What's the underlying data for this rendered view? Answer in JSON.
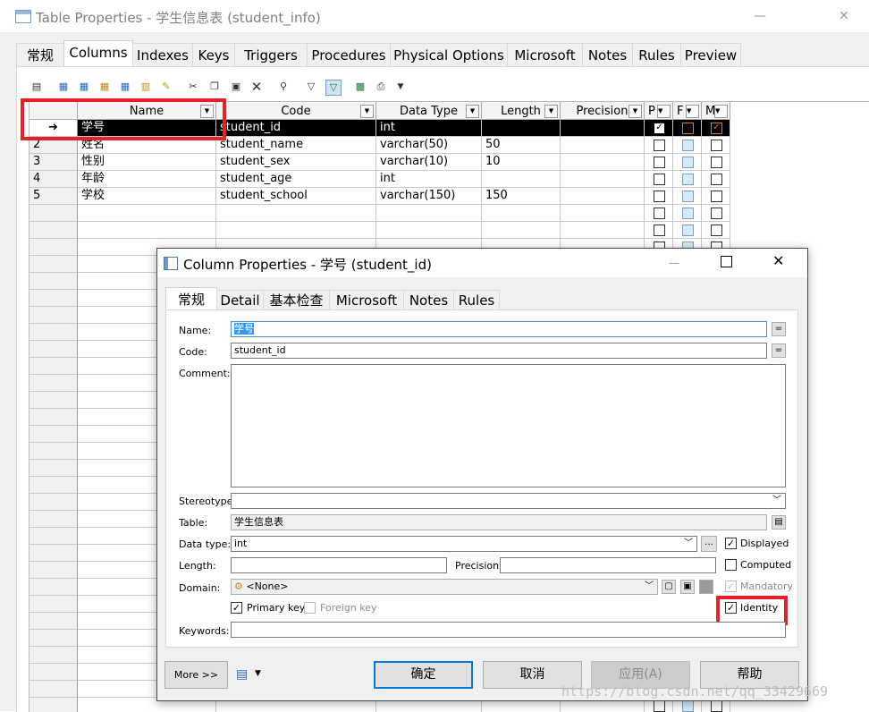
{
  "outer": {
    "title": "Table Properties - 学生信息表 (student_info)",
    "tabs": [
      "常规",
      "Columns",
      "Indexes",
      "Keys",
      "Triggers",
      "Procedures",
      "Physical Options",
      "Microsoft",
      "Notes",
      "Rules",
      "Preview"
    ],
    "active_tab": "Columns"
  },
  "grid": {
    "columns": [
      "Name",
      "Code",
      "Data Type",
      "Length",
      "Precision",
      "P",
      "F",
      "M"
    ],
    "rows": [
      {
        "num": "",
        "name": "学号",
        "code": "student_id",
        "type": "int",
        "length": "",
        "precision": "",
        "p": true,
        "f": false,
        "m": true
      },
      {
        "num": "2",
        "name": "姓名",
        "code": "student_name",
        "type": "varchar(50)",
        "length": "50",
        "precision": "",
        "p": false,
        "f": false,
        "m": false
      },
      {
        "num": "3",
        "name": "性别",
        "code": "student_sex",
        "type": "varchar(10)",
        "length": "10",
        "precision": "",
        "p": false,
        "f": false,
        "m": false
      },
      {
        "num": "4",
        "name": "年龄",
        "code": "student_age",
        "type": "int",
        "length": "",
        "precision": "",
        "p": false,
        "f": false,
        "m": false
      },
      {
        "num": "5",
        "name": "学校",
        "code": "student_school",
        "type": "varchar(150)",
        "length": "150",
        "precision": "",
        "p": false,
        "f": false,
        "m": false
      }
    ]
  },
  "dialog": {
    "title": "Column Properties - 学号 (student_id)",
    "tabs": [
      "常规",
      "Detail",
      "基本检查",
      "Microsoft",
      "Notes",
      "Rules"
    ],
    "active_tab": "常规",
    "labels": {
      "name": "Name:",
      "code": "Code:",
      "comment": "Comment:",
      "stereotype": "Stereotype:",
      "table": "Table:",
      "data_type": "Data type:",
      "length": "Length:",
      "precision": "Precision:",
      "domain": "Domain:",
      "keywords": "Keywords:"
    },
    "values": {
      "name": "学号",
      "code": "student_id",
      "comment": "",
      "stereotype": "",
      "table": "学生信息表",
      "data_type": "int",
      "length": "",
      "precision": "",
      "domain": "<None>",
      "keywords": ""
    },
    "checks": {
      "displayed": {
        "label": "Displayed",
        "checked": true
      },
      "computed": {
        "label": "Computed",
        "checked": false
      },
      "mandatory": {
        "label": "Mandatory",
        "checked": true,
        "disabled": true
      },
      "primary_key": {
        "label": "Primary key",
        "checked": true
      },
      "foreign_key": {
        "label": "Foreign key",
        "checked": false,
        "disabled": true
      },
      "identity": {
        "label": "Identity",
        "checked": true
      }
    },
    "buttons": {
      "more": "More >>",
      "ok": "确定",
      "cancel": "取消",
      "apply": "应用(A)",
      "help": "帮助"
    }
  },
  "watermark": "https://blog.csdn.net/qq_33429669"
}
